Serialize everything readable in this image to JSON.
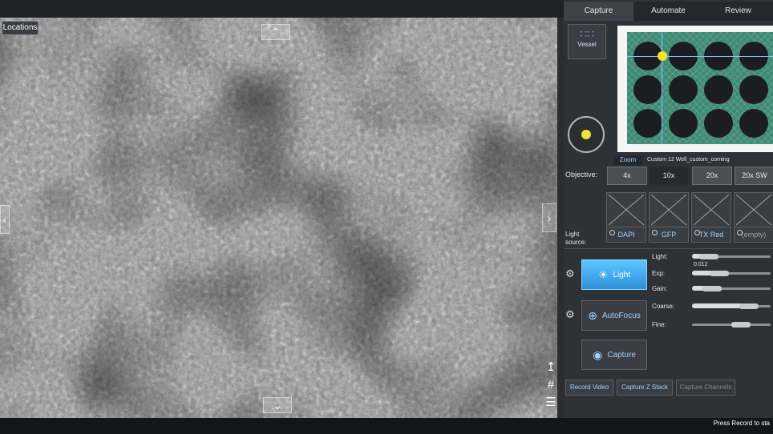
{
  "viewer": {
    "locations_tab": "Locations",
    "status_text": "Press Record to sta"
  },
  "tabs": [
    {
      "label": "Capture"
    },
    {
      "label": "Automate"
    },
    {
      "label": "Review"
    }
  ],
  "vessel": {
    "label": "Vessel",
    "name": "Custom 12 Well_custom_corning",
    "zoom_label": "Zoom"
  },
  "objective": {
    "label": "Objective:",
    "options": [
      "4x",
      "10x",
      "20x",
      "20x SW"
    ],
    "selected": "10x"
  },
  "light_source": {
    "label": "Light source:",
    "channels": [
      "DAPI",
      "GFP",
      "TX Red",
      "(empty)"
    ]
  },
  "actions": {
    "light": "Light",
    "autofocus": "AutoFocus",
    "capture": "Capture"
  },
  "sliders": {
    "light": {
      "label": "Light:",
      "fraction": 0.21
    },
    "exp": {
      "label": "Exp:",
      "value": "0.012",
      "fraction": 0.35
    },
    "gain": {
      "label": "Gain:",
      "fraction": 0.25
    },
    "coarse": {
      "label": "Coarse:",
      "fraction": 0.72
    },
    "fine": {
      "label": "Fine:",
      "fraction": 0.62
    }
  },
  "record": {
    "video": "Record Video",
    "z_stack": "Capture Z Stack",
    "channels": "Capture Channels"
  },
  "colors": {
    "accent": "#2d8fd8",
    "plate": "#3e8a72",
    "marker": "#f2e231"
  }
}
